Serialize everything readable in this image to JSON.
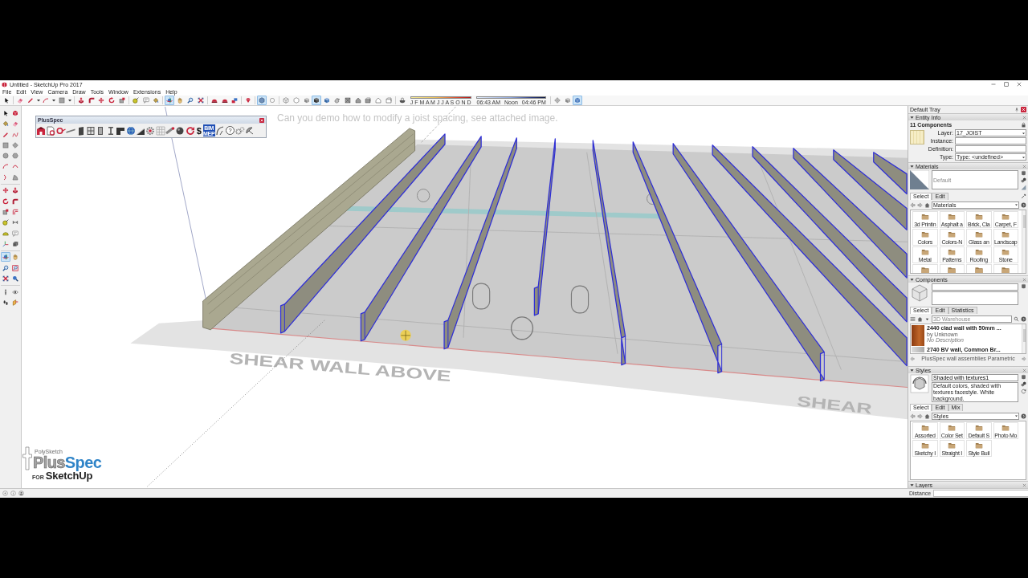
{
  "window": {
    "title": "Untitled - SketchUp Pro 2017"
  },
  "menu": [
    "File",
    "Edit",
    "View",
    "Camera",
    "Draw",
    "Tools",
    "Window",
    "Extensions",
    "Help"
  ],
  "main_toolbar": [
    {
      "selected": false
    },
    {
      "selected": false
    },
    {
      "selected": false
    },
    {
      "selected": false
    },
    {
      "selected": false
    },
    {
      "selected": false
    },
    {
      "selected": false
    },
    {
      "selected": false
    },
    {
      "selected": false
    },
    {
      "selected": false
    },
    {
      "selected": false
    },
    {
      "selected": false
    },
    {
      "selected": false
    },
    {
      "selected": true
    },
    {
      "selected": false
    },
    {
      "selected": false
    },
    {
      "selected": false
    },
    {
      "selected": false
    },
    {
      "selected": false
    },
    {
      "selected": false
    },
    {
      "selected": false
    },
    {
      "selected": true
    },
    {
      "selected": false
    },
    {
      "selected": false
    },
    {
      "selected": false
    },
    {
      "selected": false
    },
    {
      "selected": true
    },
    {
      "selected": false
    },
    {
      "selected": false
    },
    {
      "selected": false
    },
    {
      "selected": false
    },
    {
      "selected": false
    },
    {
      "selected": false
    },
    {
      "selected": false
    },
    {
      "selected": false
    },
    {
      "selected": false
    },
    {
      "selected": false
    },
    {
      "selected": true
    }
  ],
  "shadow_settings": {
    "months": "J F M A M J J A S O N D",
    "time_start": "06:43 AM",
    "time_middle": "Noon",
    "time_end": "04:46 PM"
  },
  "left_toolbar": [
    {
      "selected": false
    },
    {
      "selected": false
    },
    {
      "selected": false
    },
    {
      "selected": false
    },
    {
      "selected": false
    },
    {
      "selected": false
    },
    {
      "selected": false
    },
    {
      "selected": false
    },
    {
      "selected": false
    },
    {
      "selected": false
    },
    {
      "selected": false
    },
    {
      "selected": false
    },
    {
      "selected": false
    },
    {
      "selected": false
    },
    {
      "selected": false
    },
    {
      "selected": false
    },
    {
      "selected": false
    },
    {
      "selected": false
    },
    {
      "selected": false
    },
    {
      "selected": false
    },
    {
      "selected": false
    },
    {
      "selected": false
    },
    {
      "selected": false
    },
    {
      "selected": false
    },
    {
      "selected": false
    },
    {
      "selected": false
    },
    {
      "selected": true
    },
    {
      "selected": false
    },
    {
      "selected": false
    },
    {
      "selected": false
    },
    {
      "selected": false
    },
    {
      "selected": false
    },
    {
      "selected": false
    },
    {
      "selected": false
    },
    {
      "selected": false
    },
    {
      "selected": false
    }
  ],
  "plusspec_toolbar": {
    "title": "PlusSpec",
    "buttons": [
      {
        "kind": "icon"
      },
      {
        "kind": "icon"
      },
      {
        "kind": "icon"
      },
      {
        "kind": "icon"
      },
      {
        "kind": "icon"
      },
      {
        "kind": "icon"
      },
      {
        "kind": "icon"
      },
      {
        "kind": "icon"
      },
      {
        "kind": "icon"
      },
      {
        "kind": "icon"
      },
      {
        "kind": "icon"
      },
      {
        "kind": "icon"
      },
      {
        "kind": "icon"
      },
      {
        "kind": "icon"
      },
      {
        "kind": "icon"
      },
      {
        "kind": "icon"
      },
      {
        "kind": "text",
        "label": "$"
      },
      {
        "kind": "badge",
        "label": "BIM MEP"
      },
      {
        "kind": "icon"
      },
      {
        "kind": "help",
        "label": "?"
      },
      {
        "kind": "icon"
      },
      {
        "kind": "icon"
      }
    ]
  },
  "viewport": {
    "caption": "Can you demo how to modify a joist spacing, see attached image.",
    "plan_labels": [
      "SHEAR WALL ABOVE",
      "SHEAR"
    ]
  },
  "logo": {
    "tagline": "PolySketch",
    "wordmark": [
      "Plus",
      "Spec"
    ],
    "prefix": "FOR",
    "product": "SketchUp"
  },
  "tray": {
    "title": "Default Tray",
    "entity_info": {
      "title": "Entity Info",
      "expanded": true,
      "heading": "11 Components",
      "fields": [
        {
          "label": "Layer:",
          "kind": "select",
          "value": "17_JOIST"
        },
        {
          "label": "Instance:",
          "kind": "text"
        },
        {
          "label": "Definition:",
          "kind": "text"
        },
        {
          "label": "Type:",
          "kind": "select",
          "value": "Type: <undefined>"
        }
      ]
    },
    "materials": {
      "title": "Materials",
      "expanded": true,
      "name": "Default",
      "tabs": [
        {
          "label": "Select",
          "selected": true
        },
        {
          "label": "Edit",
          "selected": false
        }
      ],
      "library": "Materials",
      "items": [
        "3d Printin",
        "Asphalt a",
        "Brick, Cla",
        "Carpet, F",
        "Colors",
        "Colors-N",
        "Glass an",
        "Landscap",
        "Metal",
        "Patterns",
        "Roofing",
        "Stone"
      ]
    },
    "components": {
      "title": "Components",
      "expanded": true,
      "tabs": [
        {
          "label": "Select",
          "selected": true
        },
        {
          "label": "Edit",
          "selected": false
        },
        {
          "label": "Statistics",
          "selected": false
        }
      ],
      "search_placeholder": "3D Warehouse",
      "results": [
        {
          "name": "2440 clad wall with 50mm ...",
          "author": "by Unknown",
          "description": "No Description"
        },
        {
          "name": "2740 BV wall, Common Br..."
        }
      ],
      "collection": "PlusSpec wall assemblies Parametric"
    },
    "styles": {
      "title": "Styles",
      "expanded": true,
      "name": "Shaded with textures1",
      "description": "Default colors, shaded with textures facestyle. White background.",
      "tabs": [
        {
          "label": "Select",
          "selected": true
        },
        {
          "label": "Edit",
          "selected": false
        },
        {
          "label": "Mix",
          "selected": false
        }
      ],
      "library": "Styles",
      "items": [
        "Assorted",
        "Color Set",
        "Default S",
        "Photo Mo",
        "Sketchy I",
        "Straight I",
        "Style Buil"
      ]
    },
    "layers": {
      "title": "Layers",
      "expanded": true
    }
  },
  "status_bar": {
    "measurement_label": "Distance"
  }
}
